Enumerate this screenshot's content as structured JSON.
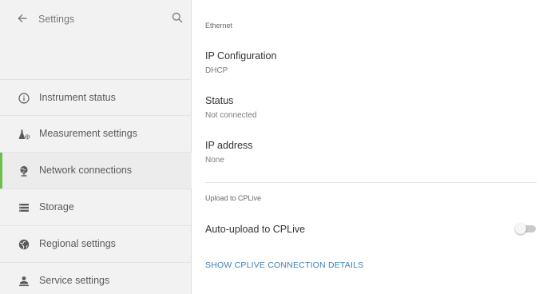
{
  "sidebar": {
    "title": "Settings",
    "back_icon": "arrow-left-icon",
    "search_icon": "search-icon",
    "items": [
      {
        "label": "Instrument status",
        "icon": "info-icon",
        "active": false
      },
      {
        "label": "Measurement settings",
        "icon": "flask-gear-icon",
        "active": false
      },
      {
        "label": "Network connections",
        "icon": "globe-stand-icon",
        "active": true
      },
      {
        "label": "Storage",
        "icon": "storage-icon",
        "active": false
      },
      {
        "label": "Regional settings",
        "icon": "world-icon",
        "active": false
      },
      {
        "label": "Service settings",
        "icon": "service-icon",
        "active": false
      }
    ]
  },
  "main": {
    "ethernet_header": "Ethernet",
    "ip_config": {
      "label": "IP Configuration",
      "value": "DHCP"
    },
    "status": {
      "label": "Status",
      "value": "Not connected"
    },
    "ip_address": {
      "label": "IP address",
      "value": "None"
    },
    "upload_header": "Upload to CPLive",
    "auto_upload": {
      "label": "Auto-upload to CPLive",
      "enabled": false
    },
    "details_link": "SHOW CPLIVE CONNECTION DETAILS"
  },
  "colors": {
    "accent": "#6cbf4a",
    "link": "#3f7fb4",
    "sidebar_bg": "#f2f2f2"
  }
}
